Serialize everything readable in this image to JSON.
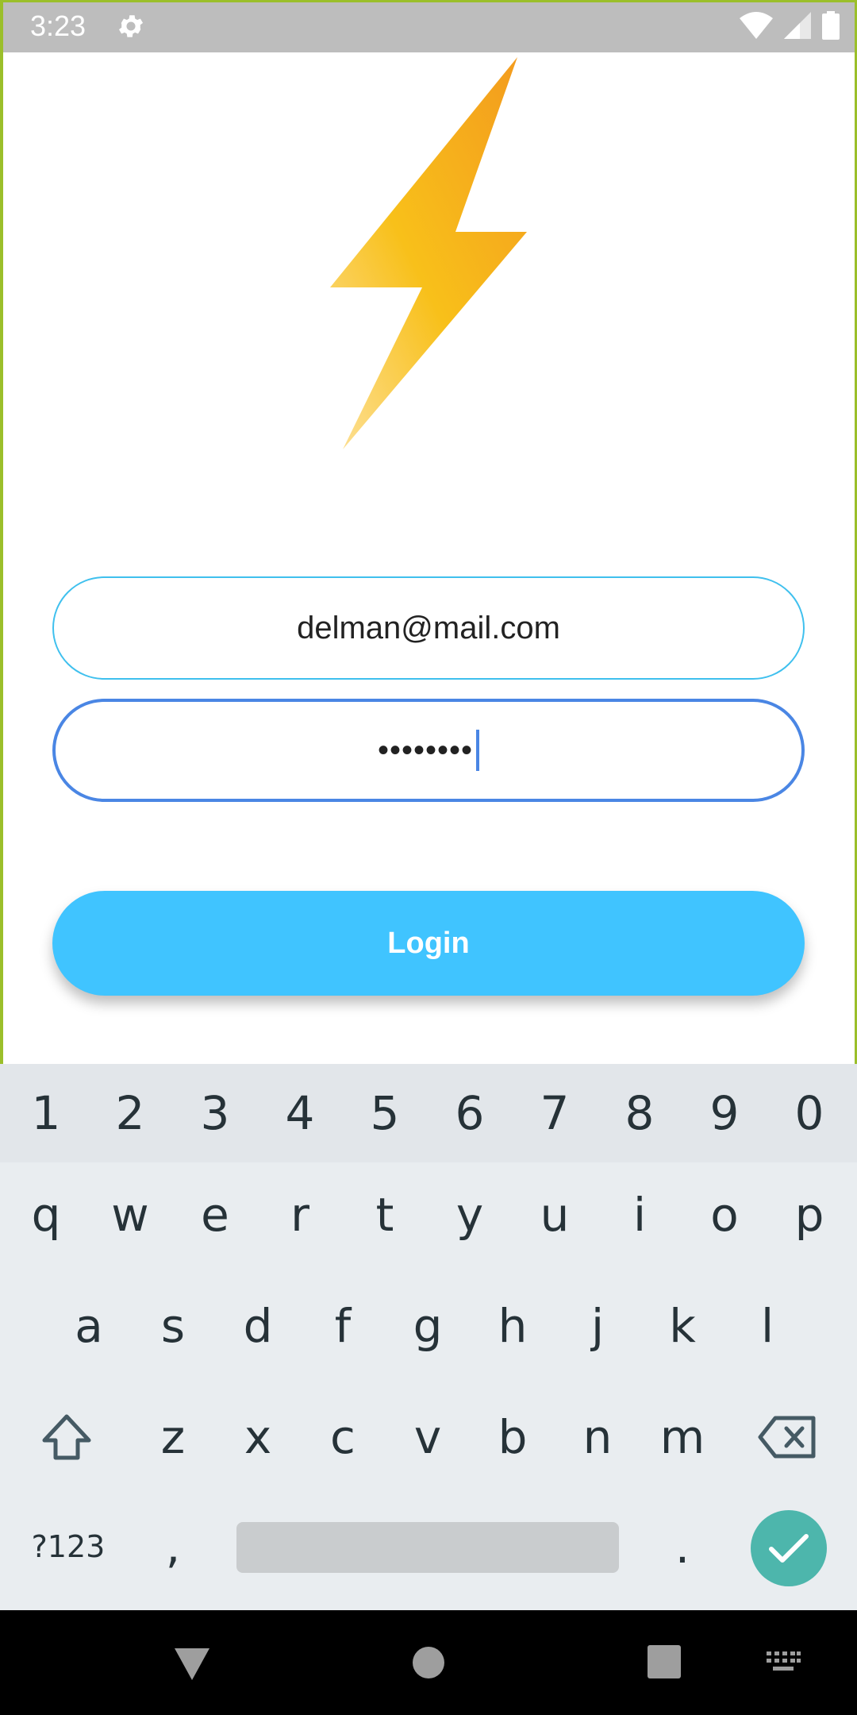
{
  "status_bar": {
    "time": "3:23"
  },
  "login_form": {
    "email_value": "delman@mail.com",
    "password_value": "••••••••",
    "login_label": "Login"
  },
  "keyboard": {
    "number_row": [
      "1",
      "2",
      "3",
      "4",
      "5",
      "6",
      "7",
      "8",
      "9",
      "0"
    ],
    "row1": [
      "q",
      "w",
      "e",
      "r",
      "t",
      "y",
      "u",
      "i",
      "o",
      "p"
    ],
    "row2": [
      "a",
      "s",
      "d",
      "f",
      "g",
      "h",
      "j",
      "k",
      "l"
    ],
    "row3": [
      "z",
      "x",
      "c",
      "v",
      "b",
      "n",
      "m"
    ],
    "symbols_label": "?123",
    "comma": ",",
    "period": "."
  },
  "colors": {
    "accent": "#40c4ff",
    "email_border": "#3fc0ee",
    "password_border": "#4a86e4",
    "enter": "#4db6ac"
  },
  "icons": [
    "settings-icon",
    "wifi-icon",
    "signal-icon",
    "battery-icon",
    "lightning-bolt-logo",
    "shift-icon",
    "backspace-icon",
    "check-icon",
    "back-icon",
    "home-icon",
    "recents-icon",
    "keyboard-icon"
  ]
}
